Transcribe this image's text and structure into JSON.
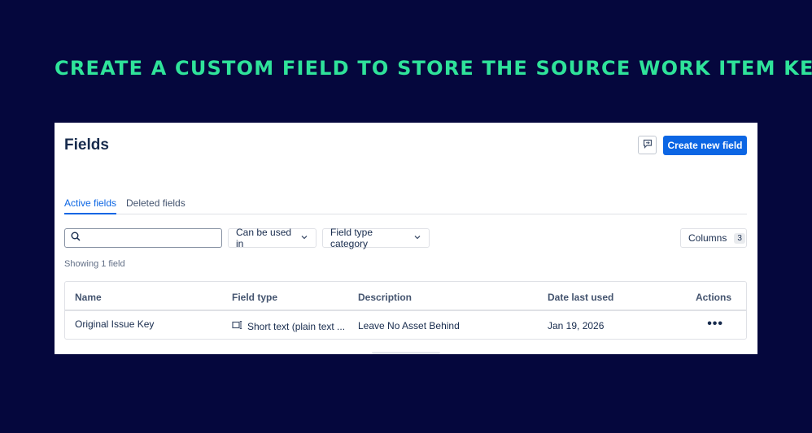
{
  "headline": "CREATE A CUSTOM FIELD TO STORE THE SOURCE WORK ITEM KEY",
  "page": {
    "title": "Fields",
    "create_button": "Create new field"
  },
  "tabs": [
    {
      "label": "Active fields",
      "active": true
    },
    {
      "label": "Deleted fields",
      "active": false
    }
  ],
  "search": {
    "value": "",
    "placeholder": ""
  },
  "filters": {
    "can_be_used_in": "Can be used in",
    "field_type_category": "Field type category"
  },
  "columns_button": {
    "label": "Columns",
    "count": "3"
  },
  "showing": "Showing 1 field",
  "table": {
    "headers": [
      "Name",
      "Field type",
      "Description",
      "Date last used",
      "Actions"
    ],
    "rows": [
      {
        "name": "Original Issue Key",
        "field_type": "Short text (plain text ...",
        "description": "Leave No Asset Behind",
        "date_last_used": "Jan 19, 2026",
        "actions": "•••"
      }
    ]
  },
  "colors": {
    "background": "#05073d",
    "headline": "#2fe39a",
    "accent": "#0c66e4"
  },
  "icons": [
    "search-icon",
    "chevron-down-icon",
    "feedback-icon",
    "short-text-icon",
    "more-icon"
  ]
}
